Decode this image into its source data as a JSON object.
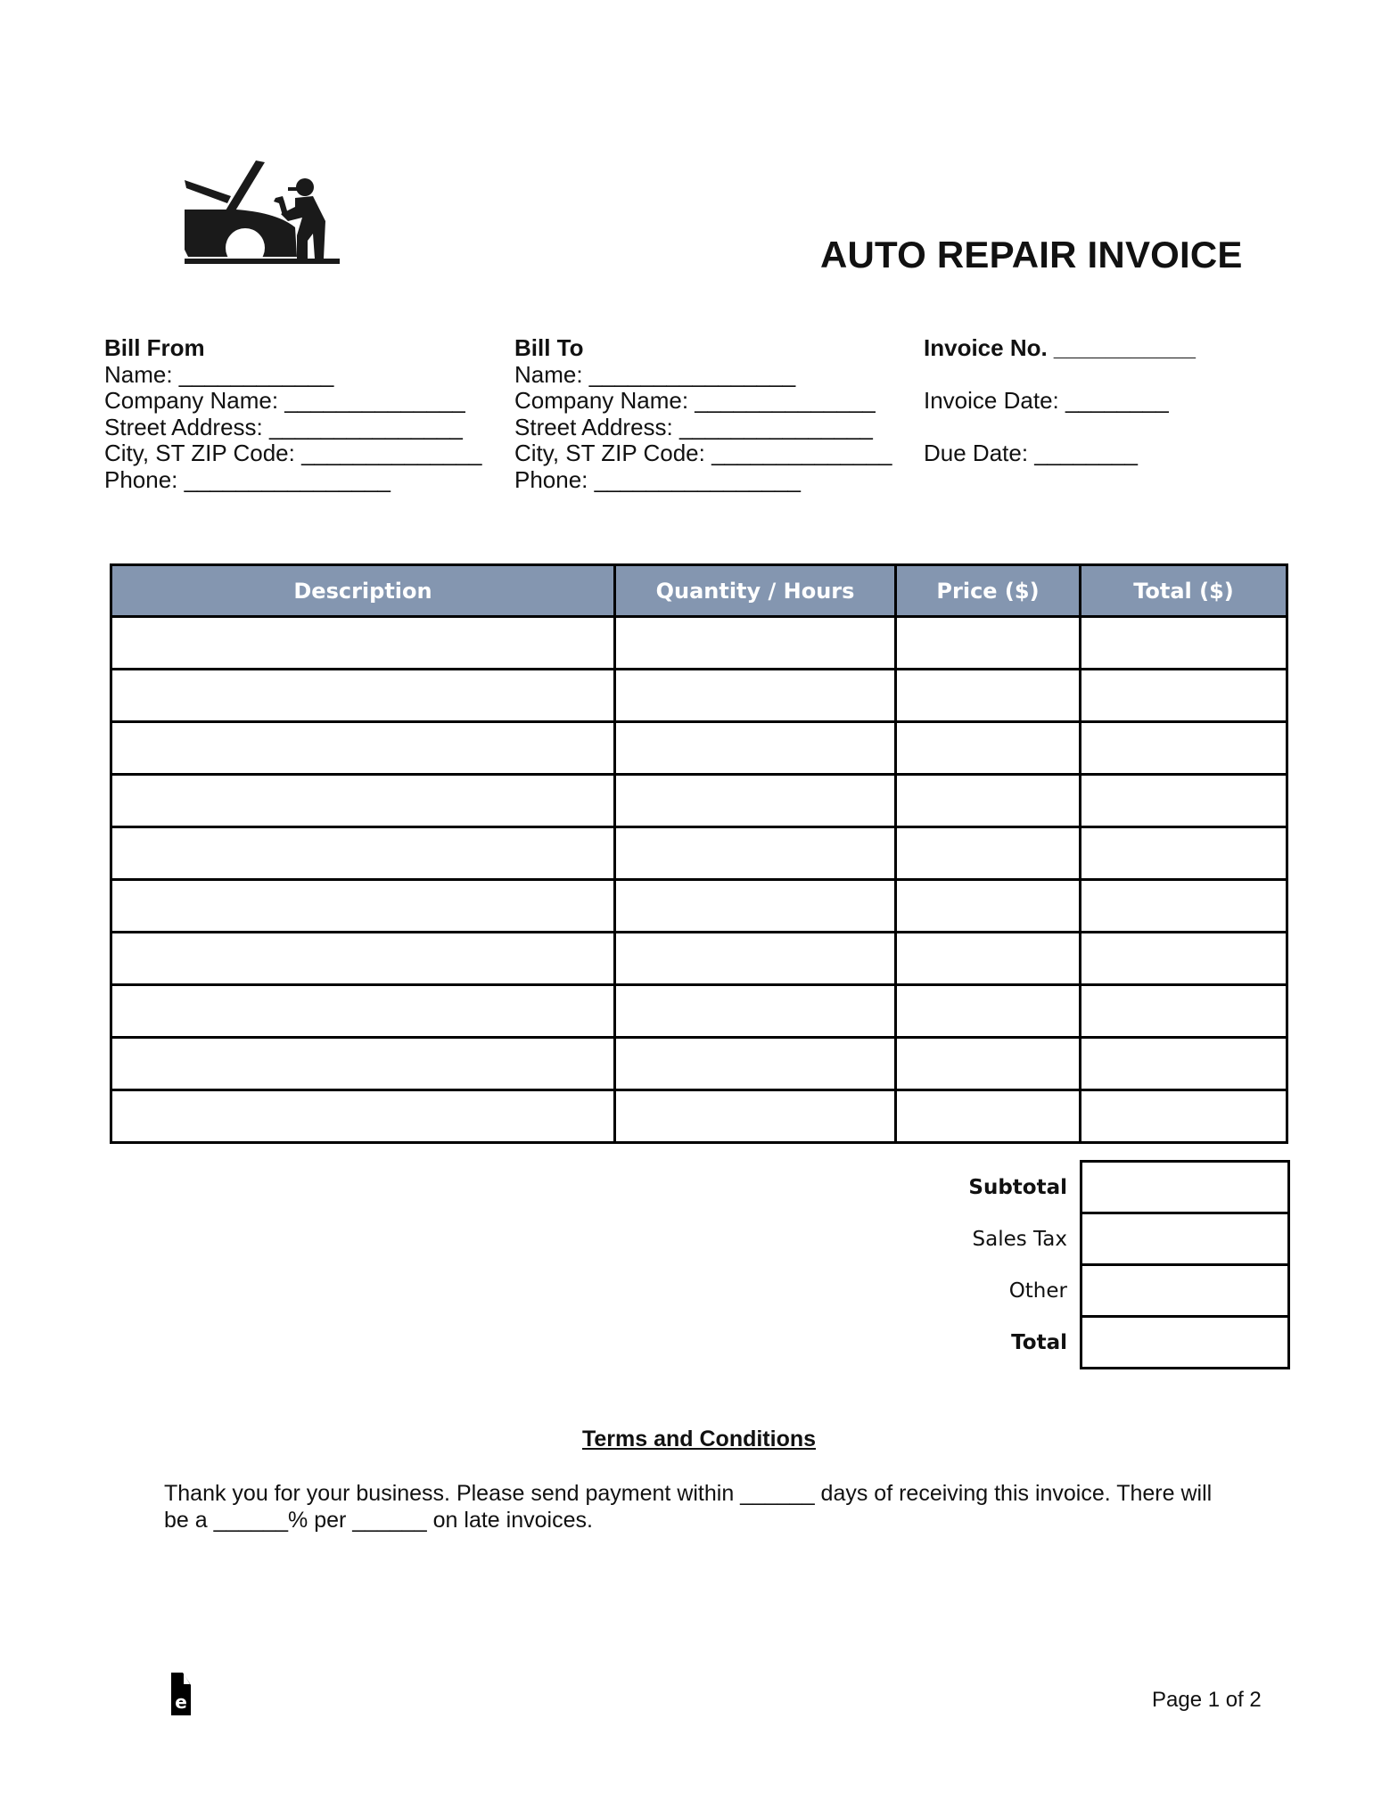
{
  "document": {
    "title": "AUTO REPAIR INVOICE",
    "logo_icon": "mechanic-car-repair-icon"
  },
  "bill_from": {
    "heading": "Bill From",
    "lines": [
      "Name: ____________",
      "Company Name: ______________",
      "Street Address: _______________",
      "City, ST ZIP Code: ______________",
      "Phone: ________________"
    ]
  },
  "bill_to": {
    "heading": "Bill To",
    "lines": [
      "Name: ________________",
      "Company Name: ______________",
      "Street Address: _______________",
      "City, ST ZIP Code: ______________",
      "Phone: ________________"
    ]
  },
  "invoice_info": {
    "invoice_no": "Invoice No. ___________",
    "invoice_date": "Invoice Date: ________",
    "due_date": "Due Date: ________"
  },
  "items_table": {
    "header_color": "#8496B0",
    "columns": [
      "Description",
      "Quantity / Hours",
      "Price ($)",
      "Total ($)"
    ],
    "rows": [
      [
        "",
        "",
        "",
        ""
      ],
      [
        "",
        "",
        "",
        ""
      ],
      [
        "",
        "",
        "",
        ""
      ],
      [
        "",
        "",
        "",
        ""
      ],
      [
        "",
        "",
        "",
        ""
      ],
      [
        "",
        "",
        "",
        ""
      ],
      [
        "",
        "",
        "",
        ""
      ],
      [
        "",
        "",
        "",
        ""
      ],
      [
        "",
        "",
        "",
        ""
      ],
      [
        "",
        "",
        "",
        ""
      ]
    ]
  },
  "totals": {
    "subtotal_label": "Subtotal",
    "sales_tax_label": "Sales Tax",
    "other_label": "Other",
    "total_label": "Total",
    "subtotal_value": "",
    "sales_tax_value": "",
    "other_value": "",
    "total_value": ""
  },
  "terms": {
    "title": "Terms and Conditions",
    "body": "Thank you for your business. Please send payment within ______ days of receiving this invoice. There will be a ______% per ______ on late invoices."
  },
  "footer": {
    "brand_icon": "eforms-document-icon",
    "page_label": "Page 1 of 2"
  }
}
